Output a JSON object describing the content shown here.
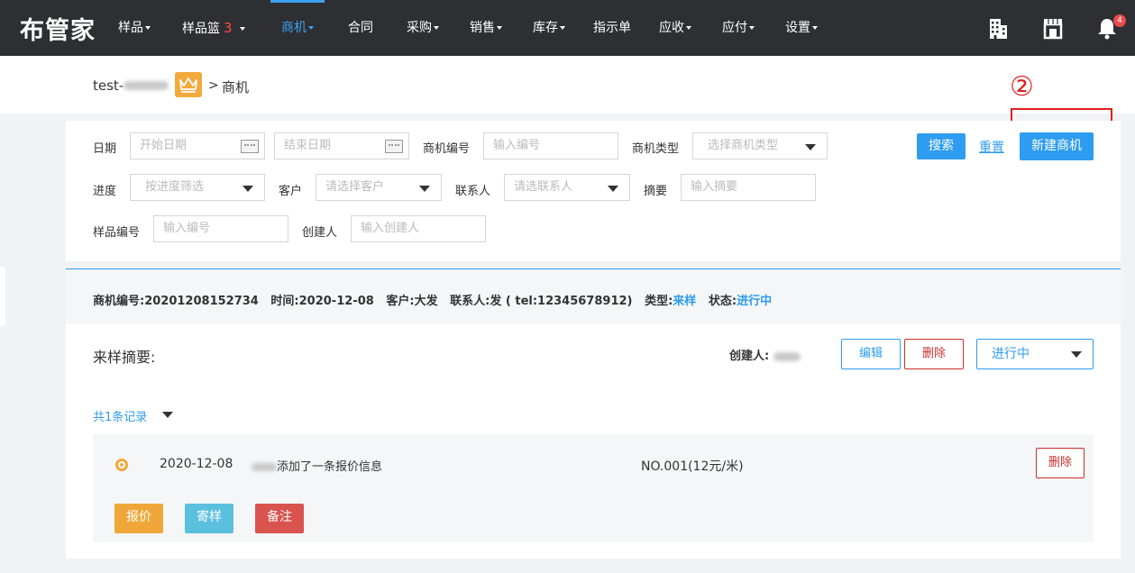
{
  "app": {
    "logo": "布管家"
  },
  "nav": {
    "items": [
      {
        "label": "样品"
      },
      {
        "label": "样品篮",
        "badge": "3"
      },
      {
        "label": "商机"
      },
      {
        "label": "合同"
      },
      {
        "label": "采购"
      },
      {
        "label": "销售"
      },
      {
        "label": "库存"
      },
      {
        "label": "指示单"
      },
      {
        "label": "应收"
      },
      {
        "label": "应付"
      },
      {
        "label": "设置"
      }
    ],
    "active_item": "商机",
    "notification_count": "4",
    "icons": [
      "building-icon",
      "store-icon",
      "bell-icon"
    ]
  },
  "breadcrumb": {
    "user": "test-",
    "separator": ">",
    "current": "商机"
  },
  "annotation": {
    "step_marker": "②"
  },
  "filters": {
    "date_label": "日期",
    "start_date_placeholder": "开始日期",
    "end_date_placeholder": "结束日期",
    "opportunity_no_label": "商机编号",
    "opportunity_no_placeholder": "输入编号",
    "opportunity_type_label": "商机类型",
    "opportunity_type_placeholder": "选择商机类型",
    "progress_label": "进度",
    "progress_placeholder": "按进度筛选",
    "customer_label": "客户",
    "customer_placeholder": "请选择客户",
    "contact_label": "联系人",
    "contact_placeholder": "请选联系人",
    "summary_label": "摘要",
    "summary_placeholder": "输入摘要",
    "sample_no_label": "样品编号",
    "sample_no_placeholder": "输入编号",
    "creator_label": "创建人",
    "creator_placeholder": "输入创建人",
    "search_button": "搜索",
    "reset_link": "重置",
    "new_button": "新建商机"
  },
  "record": {
    "header": {
      "no_label": "商机编号:",
      "no_value": "20201208152734",
      "time_label": "时间:",
      "time_value": "2020-12-08",
      "customer_label": "客户:",
      "customer_value": "大发",
      "contact_label": "联系人:",
      "contact_value": "发 ( tel:12345678912)",
      "type_label": "类型:",
      "type_value": "来样",
      "status_label": "状态:",
      "status_value": "进行中"
    },
    "summary_label": "来样摘要:",
    "creator_label": "创建人:",
    "edit_button": "编辑",
    "delete_button": "删除",
    "status_select": "进行中",
    "count_text": "共1条记录",
    "entry": {
      "date": "2020-12-08",
      "description": "添加了一条报价信息",
      "number": "NO.001(12元/米)",
      "delete_button": "删除"
    },
    "actions": {
      "quote": "报价",
      "send_sample": "寄样",
      "note": "备注"
    }
  },
  "colors": {
    "nav_bg": "#2d2f33",
    "accent": "#2e9cf0",
    "danger": "#c9302c",
    "warning": "#f0a73a",
    "info": "#5bc0de",
    "annotation": "#e02020"
  }
}
